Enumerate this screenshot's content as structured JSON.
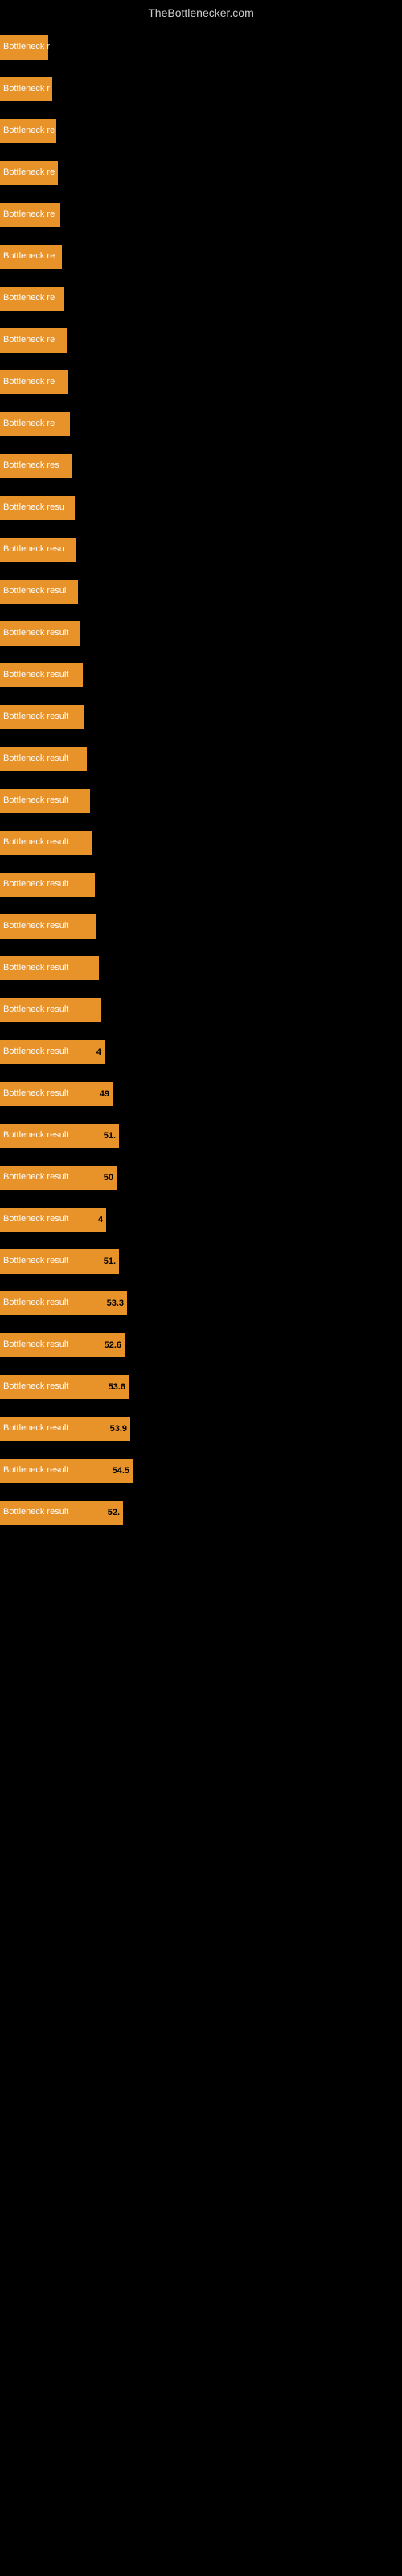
{
  "site_title": "TheBottlenecker.com",
  "bars": [
    {
      "label": "Bottleneck r",
      "value": null,
      "width": 60
    },
    {
      "label": "Bottleneck r",
      "value": null,
      "width": 65
    },
    {
      "label": "Bottleneck re",
      "value": null,
      "width": 70
    },
    {
      "label": "Bottleneck re",
      "value": null,
      "width": 72
    },
    {
      "label": "Bottleneck re",
      "value": null,
      "width": 75
    },
    {
      "label": "Bottleneck re",
      "value": null,
      "width": 77
    },
    {
      "label": "Bottleneck re",
      "value": null,
      "width": 80
    },
    {
      "label": "Bottleneck re",
      "value": null,
      "width": 83
    },
    {
      "label": "Bottleneck re",
      "value": null,
      "width": 85
    },
    {
      "label": "Bottleneck re",
      "value": null,
      "width": 87
    },
    {
      "label": "Bottleneck res",
      "value": null,
      "width": 90
    },
    {
      "label": "Bottleneck resu",
      "value": null,
      "width": 93
    },
    {
      "label": "Bottleneck resu",
      "value": null,
      "width": 95
    },
    {
      "label": "Bottleneck resul",
      "value": null,
      "width": 97
    },
    {
      "label": "Bottleneck result",
      "value": null,
      "width": 100
    },
    {
      "label": "Bottleneck result",
      "value": null,
      "width": 103
    },
    {
      "label": "Bottleneck result",
      "value": null,
      "width": 105
    },
    {
      "label": "Bottleneck result",
      "value": null,
      "width": 108
    },
    {
      "label": "Bottleneck result",
      "value": null,
      "width": 112
    },
    {
      "label": "Bottleneck result",
      "value": null,
      "width": 115
    },
    {
      "label": "Bottleneck result",
      "value": null,
      "width": 118
    },
    {
      "label": "Bottleneck result",
      "value": null,
      "width": 120
    },
    {
      "label": "Bottleneck result",
      "value": null,
      "width": 123
    },
    {
      "label": "Bottleneck result",
      "value": null,
      "width": 125
    },
    {
      "label": "Bottleneck result",
      "value": "4",
      "width": 130
    },
    {
      "label": "Bottleneck result",
      "value": "49",
      "width": 140
    },
    {
      "label": "Bottleneck result",
      "value": "51.",
      "width": 148
    },
    {
      "label": "Bottleneck result",
      "value": "50",
      "width": 145
    },
    {
      "label": "Bottleneck result",
      "value": "4",
      "width": 132
    },
    {
      "label": "Bottleneck result",
      "value": "51.",
      "width": 148
    },
    {
      "label": "Bottleneck result",
      "value": "53.3",
      "width": 158
    },
    {
      "label": "Bottleneck result",
      "value": "52.6",
      "width": 155
    },
    {
      "label": "Bottleneck result",
      "value": "53.6",
      "width": 160
    },
    {
      "label": "Bottleneck result",
      "value": "53.9",
      "width": 162
    },
    {
      "label": "Bottleneck result",
      "value": "54.5",
      "width": 165
    },
    {
      "label": "Bottleneck result",
      "value": "52.",
      "width": 153
    }
  ]
}
